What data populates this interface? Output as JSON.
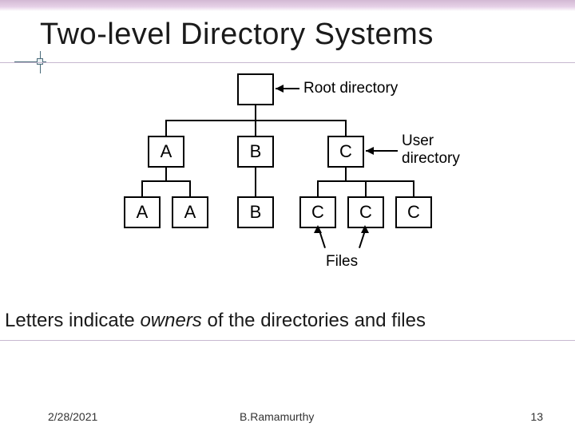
{
  "slide": {
    "title": "Two-level Directory Systems",
    "caption_prefix": "Letters indicate ",
    "caption_em": "owners",
    "caption_suffix": " of the directories and files"
  },
  "diagram": {
    "root_label_line1": "Root directory",
    "user_dir_label_line1": "User",
    "user_dir_label_line2": "directory",
    "files_label": "Files",
    "level1": [
      "A",
      "B",
      "C"
    ],
    "level2": [
      "A",
      "A",
      "B",
      "C",
      "C",
      "C"
    ]
  },
  "footer": {
    "date": "2/28/2021",
    "author": "B.Ramamurthy",
    "page": "13"
  },
  "chart_data": {
    "type": "tree",
    "title": "Two-level Directory Systems",
    "annotations": [
      "Root directory",
      "User directory",
      "Files"
    ],
    "root": {
      "name": "root",
      "children": [
        {
          "name": "A",
          "role": "user-directory",
          "children": [
            {
              "name": "A",
              "role": "file"
            },
            {
              "name": "A",
              "role": "file"
            }
          ]
        },
        {
          "name": "B",
          "role": "user-directory",
          "children": [
            {
              "name": "B",
              "role": "file"
            }
          ]
        },
        {
          "name": "C",
          "role": "user-directory",
          "children": [
            {
              "name": "C",
              "role": "file"
            },
            {
              "name": "C",
              "role": "file"
            },
            {
              "name": "C",
              "role": "file"
            }
          ]
        }
      ]
    }
  }
}
